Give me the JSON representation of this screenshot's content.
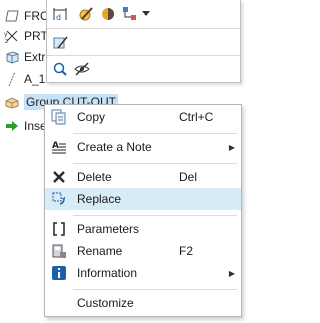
{
  "tree": {
    "items": [
      {
        "label": "FRC",
        "icon": "datum-plane-icon"
      },
      {
        "label": "PRT",
        "icon": "coordinate-system-icon"
      },
      {
        "label": "Extr",
        "icon": "extrude-icon"
      },
      {
        "label": "A_1",
        "icon": "axis-icon"
      },
      {
        "label": "Group CUT-OUT",
        "icon": "group-icon"
      },
      {
        "label": "Inse",
        "icon": "insert-here-arrow-icon"
      }
    ]
  },
  "mini_toolbar": {
    "buttons": [
      "dimensions-icon",
      "edit-definition-icon",
      "appearance-icon",
      "references-icon",
      "dropdown-arrow-icon",
      "suppress-icon",
      "zoom-to-selected-icon",
      "hide-icon"
    ]
  },
  "context_menu": {
    "items": [
      {
        "label": "Copy",
        "shortcut": "Ctrl+C",
        "icon": "copy-icon"
      },
      {
        "label": "Create a Note",
        "shortcut": "",
        "icon": "note-icon",
        "submenu": true
      },
      {
        "label": "Delete",
        "shortcut": "Del",
        "icon": "delete-x-icon"
      },
      {
        "label": "Replace",
        "shortcut": "",
        "icon": "replace-icon",
        "highlighted": true
      },
      {
        "label": "Parameters",
        "shortcut": "",
        "icon": "parameters-icon"
      },
      {
        "label": "Rename",
        "shortcut": "F2",
        "icon": "rename-icon"
      },
      {
        "label": "Information",
        "shortcut": "",
        "icon": "info-icon",
        "submenu": true
      },
      {
        "label": "Customize",
        "shortcut": "",
        "icon": ""
      }
    ],
    "submenu_arrow": "▶"
  },
  "colors": {
    "selection": "#c6e2f7",
    "hover": "#d8ecf8",
    "info_blue": "#1f5fa8",
    "delete_dark": "#2b2b2b"
  }
}
